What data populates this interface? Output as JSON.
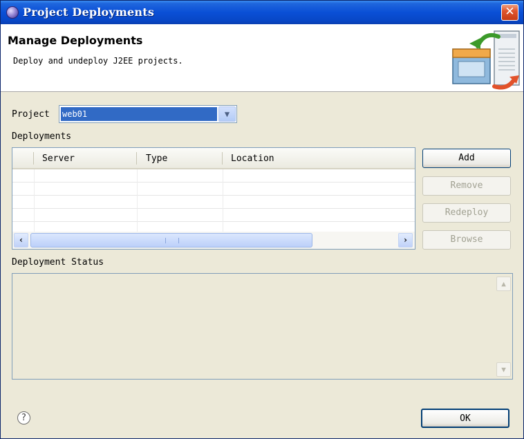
{
  "window": {
    "title": "Project Deployments"
  },
  "banner": {
    "title": "Manage Deployments",
    "description": "Deploy and undeploy J2EE projects."
  },
  "project": {
    "label": "Project",
    "selected": "web01"
  },
  "deployments": {
    "label": "Deployments",
    "columns": [
      "",
      "Server",
      "Type",
      "Location"
    ],
    "rows": [],
    "buttons": {
      "add": "Add",
      "remove": "Remove",
      "redeploy": "Redeploy",
      "browse": "Browse"
    }
  },
  "status": {
    "label": "Deployment Status",
    "text": ""
  },
  "footer": {
    "ok": "OK"
  },
  "icons": {
    "close": "close-icon",
    "help": "help-icon",
    "app": "app-icon"
  },
  "colors": {
    "titlebar": "#0a4fd6",
    "selection": "#316ac5",
    "window_bg": "#ece9d8"
  }
}
